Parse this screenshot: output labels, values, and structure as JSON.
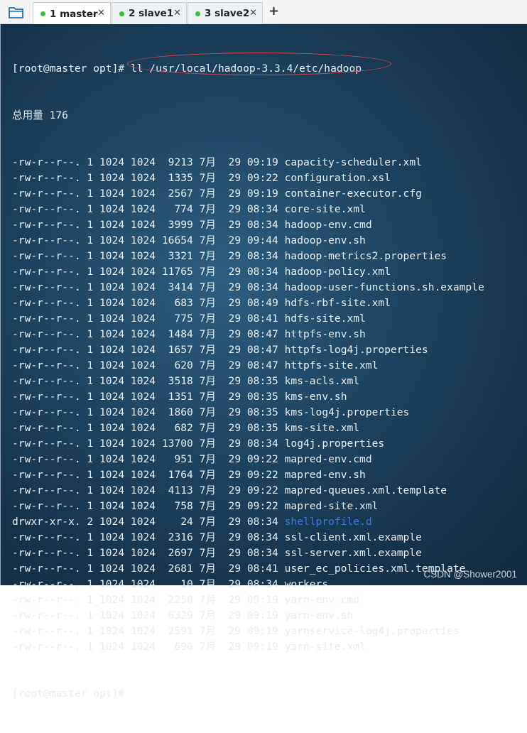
{
  "tabs": [
    {
      "label": "1 master",
      "active": true
    },
    {
      "label": "2 slave1",
      "active": false
    },
    {
      "label": "3 slave2",
      "active": false
    }
  ],
  "tab_close": "✕",
  "new_tab": "+",
  "prompt_first": "[root@master opt]# ",
  "command": "ll /usr/local/hadoop-3.3.4/etc/hadoop",
  "total": "总用量 176",
  "files": [
    {
      "perm": "-rw-r--r--.",
      "links": "1",
      "owner": "1024",
      "group": "1024",
      "size": "9213",
      "month": "7月",
      "day": "29",
      "time": "09:19",
      "name": "capacity-scheduler.xml"
    },
    {
      "perm": "-rw-r--r--.",
      "links": "1",
      "owner": "1024",
      "group": "1024",
      "size": "1335",
      "month": "7月",
      "day": "29",
      "time": "09:22",
      "name": "configuration.xsl"
    },
    {
      "perm": "-rw-r--r--.",
      "links": "1",
      "owner": "1024",
      "group": "1024",
      "size": "2567",
      "month": "7月",
      "day": "29",
      "time": "09:19",
      "name": "container-executor.cfg"
    },
    {
      "perm": "-rw-r--r--.",
      "links": "1",
      "owner": "1024",
      "group": "1024",
      "size": "774",
      "month": "7月",
      "day": "29",
      "time": "08:34",
      "name": "core-site.xml"
    },
    {
      "perm": "-rw-r--r--.",
      "links": "1",
      "owner": "1024",
      "group": "1024",
      "size": "3999",
      "month": "7月",
      "day": "29",
      "time": "08:34",
      "name": "hadoop-env.cmd"
    },
    {
      "perm": "-rw-r--r--.",
      "links": "1",
      "owner": "1024",
      "group": "1024",
      "size": "16654",
      "month": "7月",
      "day": "29",
      "time": "09:44",
      "name": "hadoop-env.sh"
    },
    {
      "perm": "-rw-r--r--.",
      "links": "1",
      "owner": "1024",
      "group": "1024",
      "size": "3321",
      "month": "7月",
      "day": "29",
      "time": "08:34",
      "name": "hadoop-metrics2.properties"
    },
    {
      "perm": "-rw-r--r--.",
      "links": "1",
      "owner": "1024",
      "group": "1024",
      "size": "11765",
      "month": "7月",
      "day": "29",
      "time": "08:34",
      "name": "hadoop-policy.xml"
    },
    {
      "perm": "-rw-r--r--.",
      "links": "1",
      "owner": "1024",
      "group": "1024",
      "size": "3414",
      "month": "7月",
      "day": "29",
      "time": "08:34",
      "name": "hadoop-user-functions.sh.example"
    },
    {
      "perm": "-rw-r--r--.",
      "links": "1",
      "owner": "1024",
      "group": "1024",
      "size": "683",
      "month": "7月",
      "day": "29",
      "time": "08:49",
      "name": "hdfs-rbf-site.xml"
    },
    {
      "perm": "-rw-r--r--.",
      "links": "1",
      "owner": "1024",
      "group": "1024",
      "size": "775",
      "month": "7月",
      "day": "29",
      "time": "08:41",
      "name": "hdfs-site.xml"
    },
    {
      "perm": "-rw-r--r--.",
      "links": "1",
      "owner": "1024",
      "group": "1024",
      "size": "1484",
      "month": "7月",
      "day": "29",
      "time": "08:47",
      "name": "httpfs-env.sh"
    },
    {
      "perm": "-rw-r--r--.",
      "links": "1",
      "owner": "1024",
      "group": "1024",
      "size": "1657",
      "month": "7月",
      "day": "29",
      "time": "08:47",
      "name": "httpfs-log4j.properties"
    },
    {
      "perm": "-rw-r--r--.",
      "links": "1",
      "owner": "1024",
      "group": "1024",
      "size": "620",
      "month": "7月",
      "day": "29",
      "time": "08:47",
      "name": "httpfs-site.xml"
    },
    {
      "perm": "-rw-r--r--.",
      "links": "1",
      "owner": "1024",
      "group": "1024",
      "size": "3518",
      "month": "7月",
      "day": "29",
      "time": "08:35",
      "name": "kms-acls.xml"
    },
    {
      "perm": "-rw-r--r--.",
      "links": "1",
      "owner": "1024",
      "group": "1024",
      "size": "1351",
      "month": "7月",
      "day": "29",
      "time": "08:35",
      "name": "kms-env.sh"
    },
    {
      "perm": "-rw-r--r--.",
      "links": "1",
      "owner": "1024",
      "group": "1024",
      "size": "1860",
      "month": "7月",
      "day": "29",
      "time": "08:35",
      "name": "kms-log4j.properties"
    },
    {
      "perm": "-rw-r--r--.",
      "links": "1",
      "owner": "1024",
      "group": "1024",
      "size": "682",
      "month": "7月",
      "day": "29",
      "time": "08:35",
      "name": "kms-site.xml"
    },
    {
      "perm": "-rw-r--r--.",
      "links": "1",
      "owner": "1024",
      "group": "1024",
      "size": "13700",
      "month": "7月",
      "day": "29",
      "time": "08:34",
      "name": "log4j.properties"
    },
    {
      "perm": "-rw-r--r--.",
      "links": "1",
      "owner": "1024",
      "group": "1024",
      "size": "951",
      "month": "7月",
      "day": "29",
      "time": "09:22",
      "name": "mapred-env.cmd"
    },
    {
      "perm": "-rw-r--r--.",
      "links": "1",
      "owner": "1024",
      "group": "1024",
      "size": "1764",
      "month": "7月",
      "day": "29",
      "time": "09:22",
      "name": "mapred-env.sh"
    },
    {
      "perm": "-rw-r--r--.",
      "links": "1",
      "owner": "1024",
      "group": "1024",
      "size": "4113",
      "month": "7月",
      "day": "29",
      "time": "09:22",
      "name": "mapred-queues.xml.template"
    },
    {
      "perm": "-rw-r--r--.",
      "links": "1",
      "owner": "1024",
      "group": "1024",
      "size": "758",
      "month": "7月",
      "day": "29",
      "time": "09:22",
      "name": "mapred-site.xml"
    },
    {
      "perm": "drwxr-xr-x.",
      "links": "2",
      "owner": "1024",
      "group": "1024",
      "size": "24",
      "month": "7月",
      "day": "29",
      "time": "08:34",
      "name": "shellprofile.d",
      "is_dir": true
    },
    {
      "perm": "-rw-r--r--.",
      "links": "1",
      "owner": "1024",
      "group": "1024",
      "size": "2316",
      "month": "7月",
      "day": "29",
      "time": "08:34",
      "name": "ssl-client.xml.example"
    },
    {
      "perm": "-rw-r--r--.",
      "links": "1",
      "owner": "1024",
      "group": "1024",
      "size": "2697",
      "month": "7月",
      "day": "29",
      "time": "08:34",
      "name": "ssl-server.xml.example"
    },
    {
      "perm": "-rw-r--r--.",
      "links": "1",
      "owner": "1024",
      "group": "1024",
      "size": "2681",
      "month": "7月",
      "day": "29",
      "time": "08:41",
      "name": "user_ec_policies.xml.template"
    },
    {
      "perm": "-rw-r--r--.",
      "links": "1",
      "owner": "1024",
      "group": "1024",
      "size": "10",
      "month": "7月",
      "day": "29",
      "time": "08:34",
      "name": "workers"
    },
    {
      "perm": "-rw-r--r--.",
      "links": "1",
      "owner": "1024",
      "group": "1024",
      "size": "2250",
      "month": "7月",
      "day": "29",
      "time": "09:19",
      "name": "yarn-env.cmd"
    },
    {
      "perm": "-rw-r--r--.",
      "links": "1",
      "owner": "1024",
      "group": "1024",
      "size": "6329",
      "month": "7月",
      "day": "29",
      "time": "09:19",
      "name": "yarn-env.sh"
    },
    {
      "perm": "-rw-r--r--.",
      "links": "1",
      "owner": "1024",
      "group": "1024",
      "size": "2591",
      "month": "7月",
      "day": "29",
      "time": "09:19",
      "name": "yarnservice-log4j.properties"
    },
    {
      "perm": "-rw-r--r--.",
      "links": "1",
      "owner": "1024",
      "group": "1024",
      "size": "690",
      "month": "7月",
      "day": "29",
      "time": "09:19",
      "name": "yarn-site.xml"
    }
  ],
  "prompt_last": "[root@master opt]#",
  "watermark": "CSDN @Shower2001",
  "colors": {
    "dir": "#3a7ad8",
    "text": "#e8eef2",
    "active_dot": "#35c13a",
    "highlight": "#d9484f"
  }
}
